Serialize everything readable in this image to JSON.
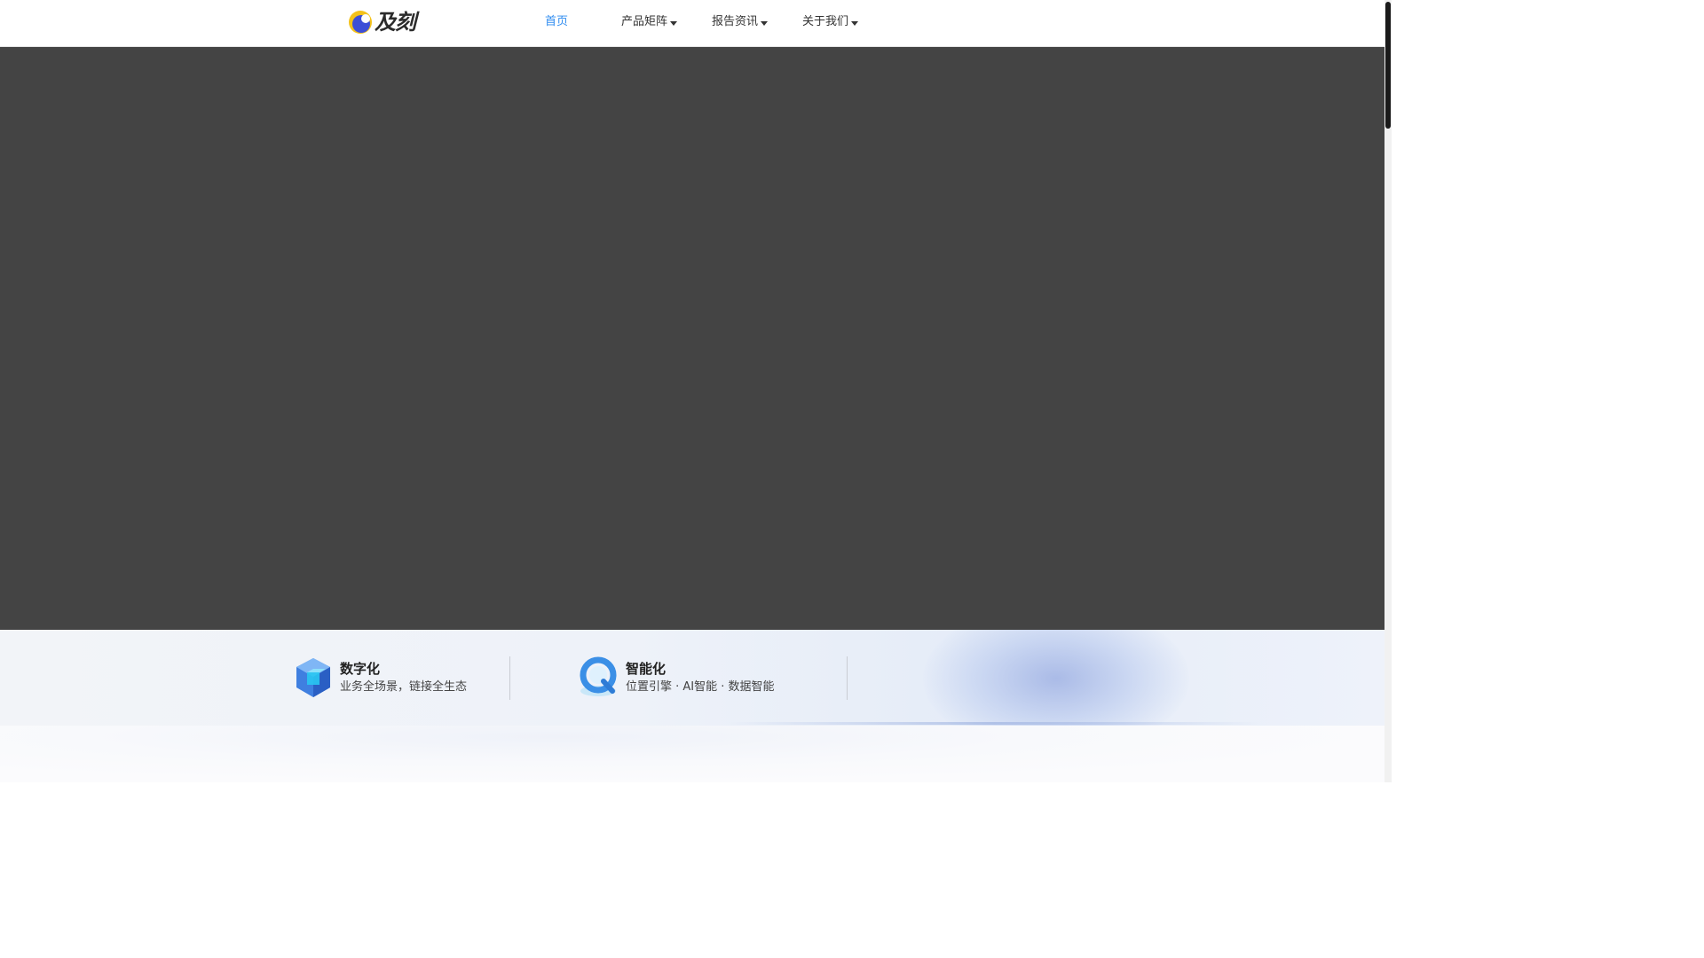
{
  "header": {
    "logo_text": "及刻",
    "nav": [
      {
        "label": "首页",
        "active": true,
        "has_dropdown": false
      },
      {
        "label": "产品矩阵",
        "active": false,
        "has_dropdown": true
      },
      {
        "label": "报告资讯",
        "active": false,
        "has_dropdown": true
      },
      {
        "label": "关于我们",
        "active": false,
        "has_dropdown": true
      }
    ]
  },
  "hero": {
    "background": "#444444"
  },
  "features": [
    {
      "title": "数字化",
      "desc": "业务全场景，链接全生态",
      "icon": "cube-icon"
    },
    {
      "title": "智能化",
      "desc": "位置引擎 · AI智能 · 数据智能",
      "icon": "q-search-icon"
    }
  ],
  "colors": {
    "accent": "#2f8cf0",
    "text": "#333333",
    "hero": "#444444"
  }
}
